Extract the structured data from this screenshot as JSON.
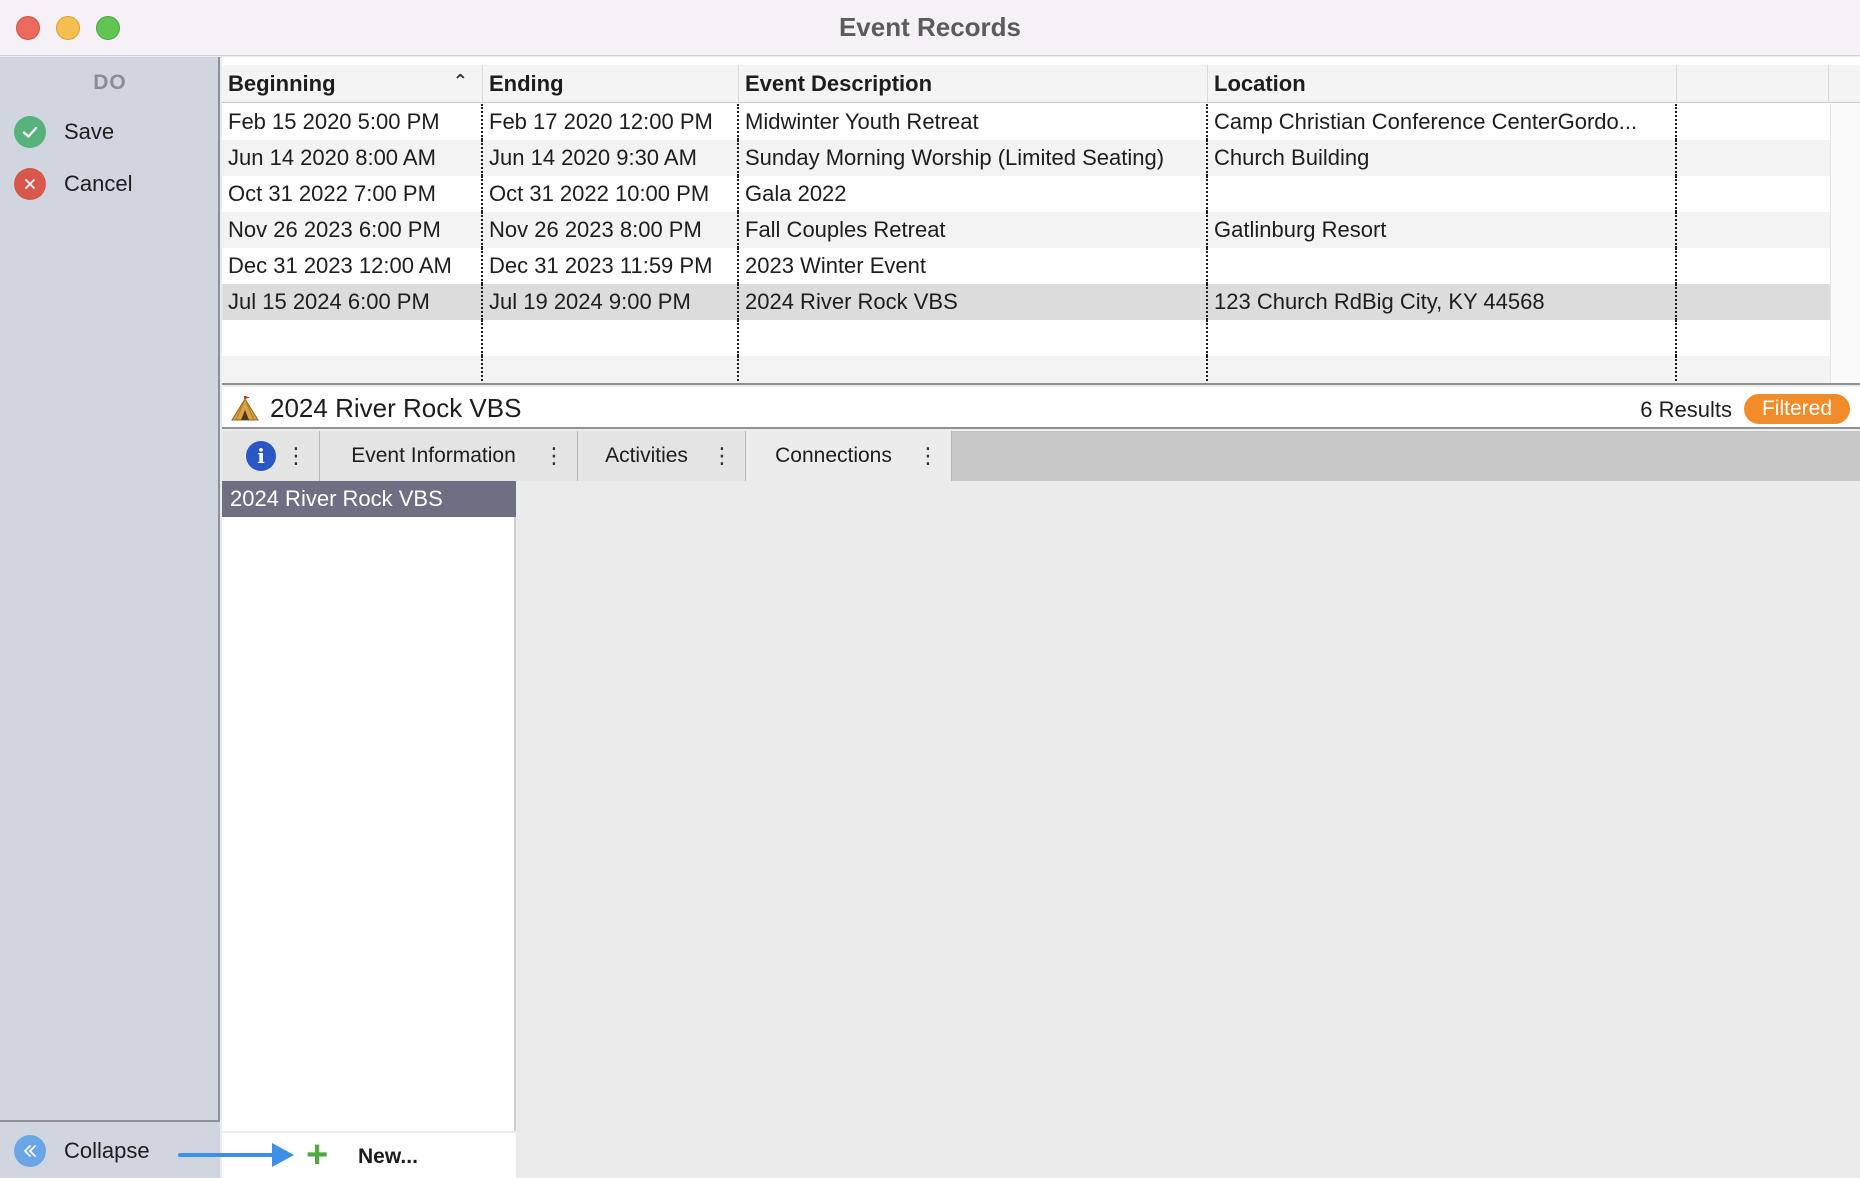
{
  "window": {
    "title": "Event Records"
  },
  "sidebar": {
    "section_label": "DO",
    "save_label": "Save",
    "cancel_label": "Cancel",
    "collapse_label": "Collapse"
  },
  "table": {
    "columns": [
      "Beginning",
      "Ending",
      "Event Description",
      "Location",
      ""
    ],
    "sort_column": "Beginning",
    "rows": [
      {
        "beginning": "Feb 15 2020 5:00 PM",
        "ending": "Feb 17 2020 12:00 PM",
        "description": "Midwinter Youth Retreat",
        "location": "Camp Christian Conference CenterGordo..."
      },
      {
        "beginning": "Jun 14 2020 8:00 AM",
        "ending": "Jun 14 2020 9:30 AM",
        "description": "Sunday Morning Worship (Limited Seating)",
        "location": "Church Building"
      },
      {
        "beginning": "Oct 31 2022 7:00 PM",
        "ending": "Oct 31 2022 10:00 PM",
        "description": "Gala 2022",
        "location": ""
      },
      {
        "beginning": "Nov 26 2023 6:00 PM",
        "ending": "Nov 26 2023 8:00 PM",
        "description": "Fall Couples Retreat",
        "location": "Gatlinburg Resort"
      },
      {
        "beginning": "Dec 31 2023 12:00 AM",
        "ending": "Dec 31 2023 11:59 PM",
        "description": "2023 Winter Event",
        "location": ""
      },
      {
        "beginning": "Jul 15 2024 6:00 PM",
        "ending": "Jul 19 2024 9:00 PM",
        "description": "2024 River Rock VBS",
        "location": "123 Church RdBig City, KY 44568"
      },
      {
        "beginning": "",
        "ending": "",
        "description": "",
        "location": ""
      },
      {
        "beginning": "",
        "ending": "",
        "description": "",
        "location": ""
      }
    ],
    "selected_row": 5
  },
  "record": {
    "title": "2024 River Rock VBS",
    "results_text": "6 Results",
    "filter_badge": "Filtered"
  },
  "tabs": [
    {
      "label": "",
      "icon": "info-icon"
    },
    {
      "label": "Event Information"
    },
    {
      "label": "Activities"
    },
    {
      "label": "Connections"
    }
  ],
  "active_tab": "Connections",
  "connections": {
    "list_header": "2024 River Rock VBS",
    "new_label": "New..."
  },
  "colors": {
    "accent": "#f28c2b",
    "selected_row": "#dcdcdc",
    "list_header": "#6e6f82"
  }
}
